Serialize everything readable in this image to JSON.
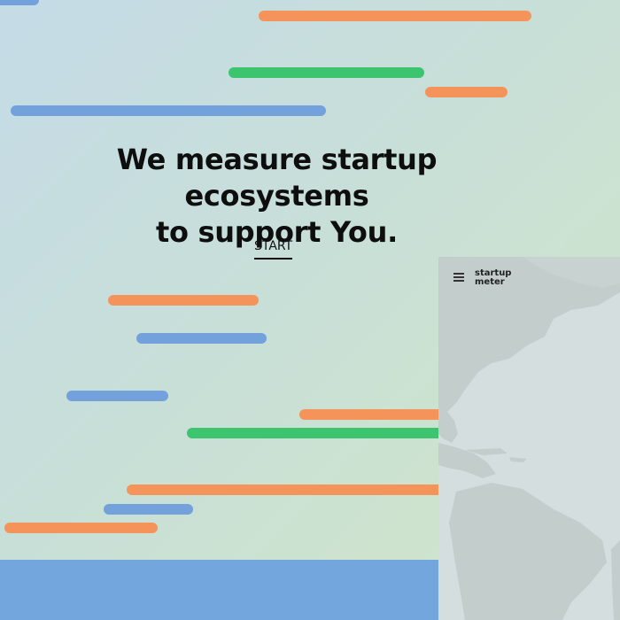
{
  "hero": {
    "headline_line1": "We measure startup ecosystems",
    "headline_line2": "to support You.",
    "cta_label": "START"
  },
  "map_panel": {
    "menu_icon": "hamburger-menu-icon",
    "logo_line1": "startup",
    "logo_line2": "meter"
  },
  "colors": {
    "stripe_orange": "#f5945a",
    "stripe_green": "#3dc46e",
    "stripe_blue": "#72a1dc",
    "bottom_band": "#72a6dc",
    "map_land": "#c3cdcc",
    "map_water": "#d4dede"
  }
}
